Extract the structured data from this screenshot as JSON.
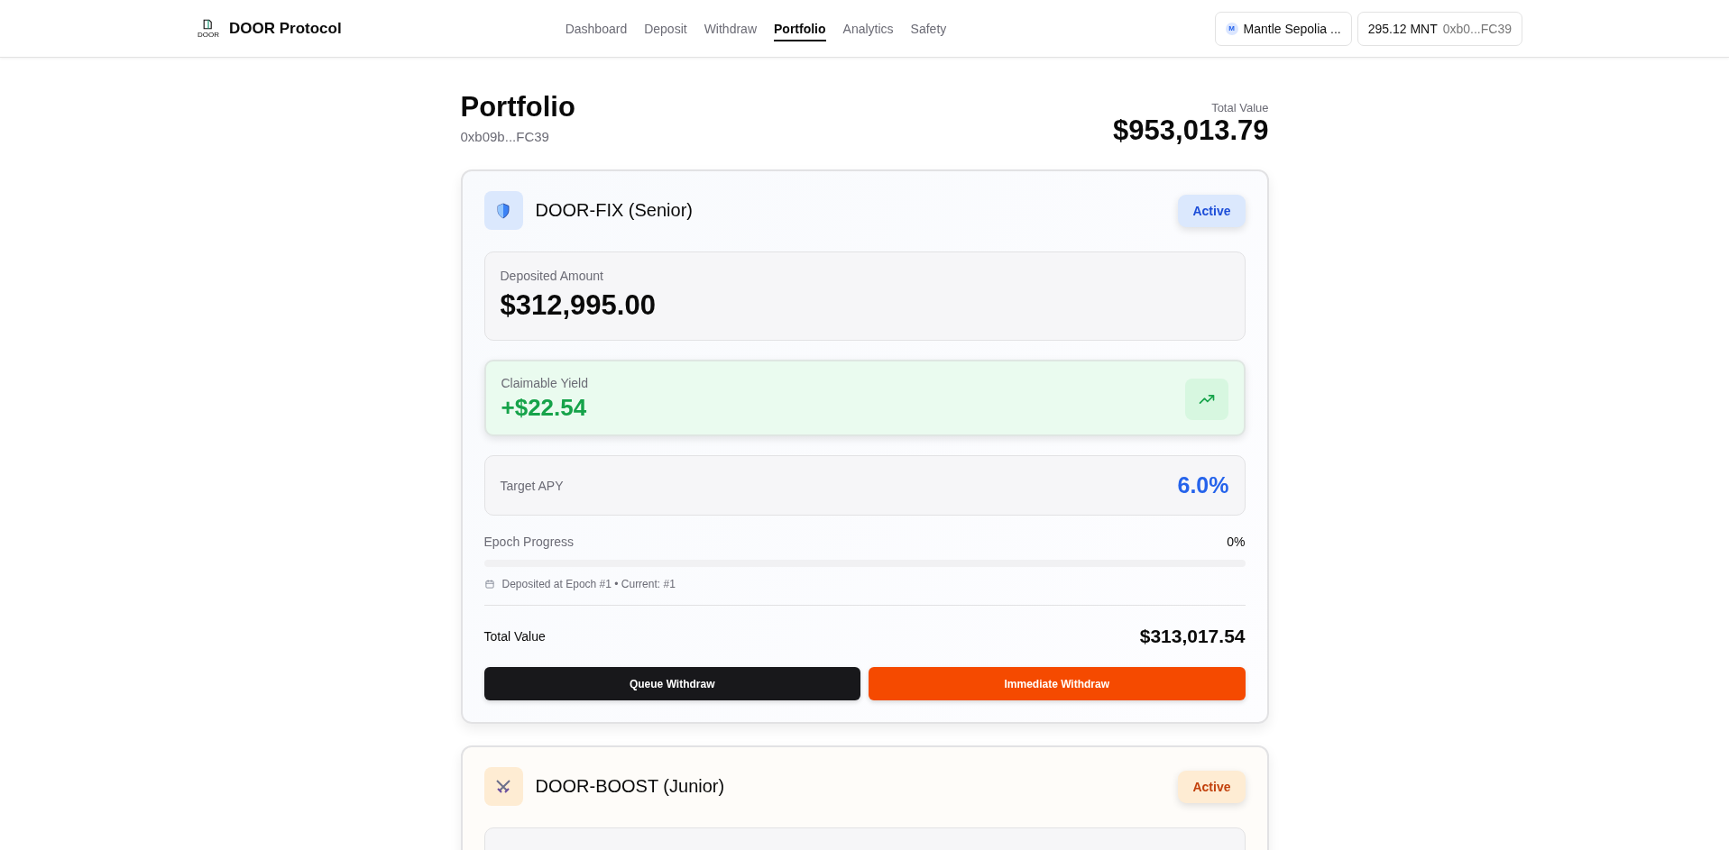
{
  "header": {
    "brand": {
      "logo_text": "DOOR",
      "name": "DOOR Protocol"
    },
    "nav": [
      {
        "label": "Dashboard",
        "selected": false
      },
      {
        "label": "Deposit",
        "selected": false
      },
      {
        "label": "Withdraw",
        "selected": false
      },
      {
        "label": "Portfolio",
        "selected": true
      },
      {
        "label": "Analytics",
        "selected": false
      },
      {
        "label": "Safety",
        "selected": false
      }
    ],
    "network": {
      "badge": "M",
      "name": "Mantle Sepolia ..."
    },
    "wallet": {
      "balance": "295.12 MNT",
      "address": "0xb0...FC39"
    }
  },
  "page": {
    "title": "Portfolio",
    "address": "0xb09b...FC39",
    "total_label": "Total Value",
    "total_value": "$953,013.79"
  },
  "positions": [
    {
      "kind": "senior",
      "name": "DOOR-FIX (Senior)",
      "status": "Active",
      "deposited": {
        "label": "Deposited Amount",
        "value": "$312,995.00"
      },
      "yield": {
        "label": "Claimable Yield",
        "value": "+$22.54"
      },
      "apy": {
        "label": "Target APY",
        "value": "6.0%"
      },
      "epoch": {
        "label": "Epoch Progress",
        "reading": "0%",
        "level": 0,
        "note": "Deposited at Epoch #1 • Current: #1"
      },
      "total": {
        "label": "Total Value",
        "value": "$313,017.54"
      },
      "buttons": [
        {
          "kind": "dark",
          "label": "Queue Withdraw"
        },
        {
          "kind": "accent",
          "label": "Immediate Withdraw"
        }
      ]
    },
    {
      "kind": "junior",
      "name": "DOOR-BOOST (Junior)",
      "status": "Active"
    }
  ]
}
